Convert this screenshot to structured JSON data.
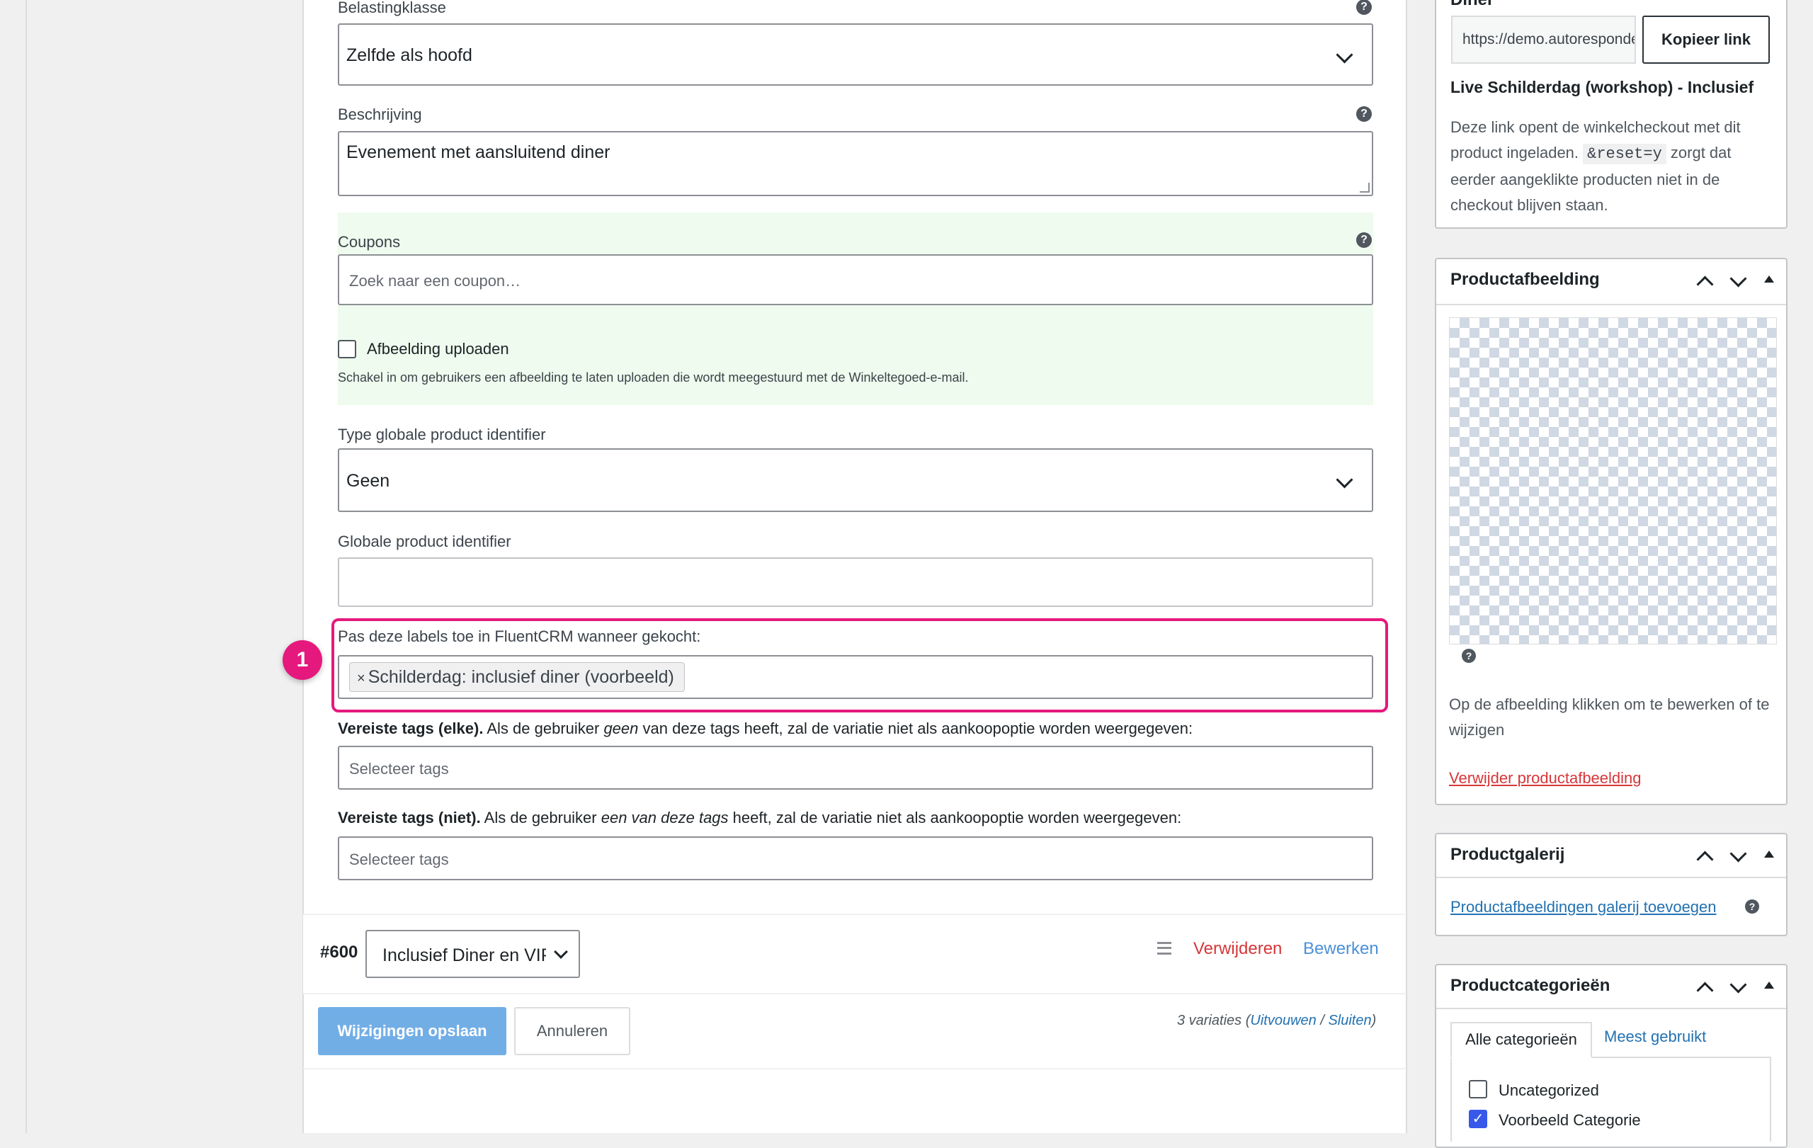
{
  "main": {
    "tax_class": {
      "label": "Belastingklasse",
      "value": "Zelfde als hoofd"
    },
    "description": {
      "label": "Beschrijving",
      "value": "Evenement met aansluitend diner"
    },
    "coupons": {
      "label": "Coupons",
      "placeholder": "Zoek naar een coupon…"
    },
    "upload_image": {
      "label": "Afbeelding uploaden",
      "help": "Schakel in om gebruikers een afbeelding te laten uploaden die wordt meegestuurd met de Winkeltegoed-e-mail."
    },
    "gpi_type": {
      "label": "Type globale product identifier",
      "value": "Geen"
    },
    "gpi": {
      "label": "Globale product identifier",
      "value": ""
    },
    "fluentcrm": {
      "label": "Pas deze labels toe in FluentCRM wanneer gekocht:",
      "tag": "Schilderdag: inclusief diner (voorbeeld)",
      "remove": "×",
      "callout": "1"
    },
    "required_any": {
      "bold": "Vereiste tags (elke).",
      "pre": " Als de gebruiker ",
      "em": "geen",
      "post": " van deze tags heeft, zal de variatie niet als aankoopoptie worden weergegeven:",
      "placeholder": "Selecteer tags"
    },
    "required_not": {
      "bold": "Vereiste tags (niet).",
      "pre": " Als de gebruiker ",
      "em": "een van deze tags",
      "post": " heeft, zal de variatie niet als aankoopoptie worden weergegeven:",
      "placeholder": "Selecteer tags"
    },
    "variation": {
      "id": "#600",
      "select": "Inclusief Diner en VIP",
      "remove": "Verwijderen",
      "edit": "Bewerken"
    },
    "footer": {
      "save": "Wijzigingen opslaan",
      "cancel": "Annuleren",
      "count": "3 variaties (",
      "expand": "Uitvouwen",
      "sep": " / ",
      "close": "Sluiten",
      "end": ")"
    }
  },
  "sidebar": {
    "link_box": {
      "heading": "Diner",
      "url": "https://demo.autoresponder",
      "copy": "Kopieer link",
      "product": "Live Schilderdag (workshop) - Inclusief",
      "text1": "Deze link opent de winkelcheckout met dit product ingeladen.",
      "code": "&reset=y",
      "text2": "zorgt dat eerder aangeklikte producten niet in de checkout blijven staan."
    },
    "product_image": {
      "title": "Productafbeelding",
      "hint": "Op de afbeelding klikken om te bewerken of te wijzigen",
      "remove": "Verwijder productafbeelding"
    },
    "gallery": {
      "title": "Productgalerij",
      "add": "Productafbeeldingen galerij toevoegen"
    },
    "categories": {
      "title": "Productcategorieën",
      "tab_all": "Alle categorieën",
      "tab_popular": "Meest gebruikt",
      "items": [
        {
          "label": "Uncategorized",
          "checked": false
        },
        {
          "label": "Voorbeeld Categorie",
          "checked": true
        }
      ]
    }
  },
  "colors": {
    "accent": "#e5197d",
    "link": "#2271b1",
    "danger": "#d63638",
    "primary_button": "#72aee6",
    "highlight_bg": "#eefbee"
  }
}
